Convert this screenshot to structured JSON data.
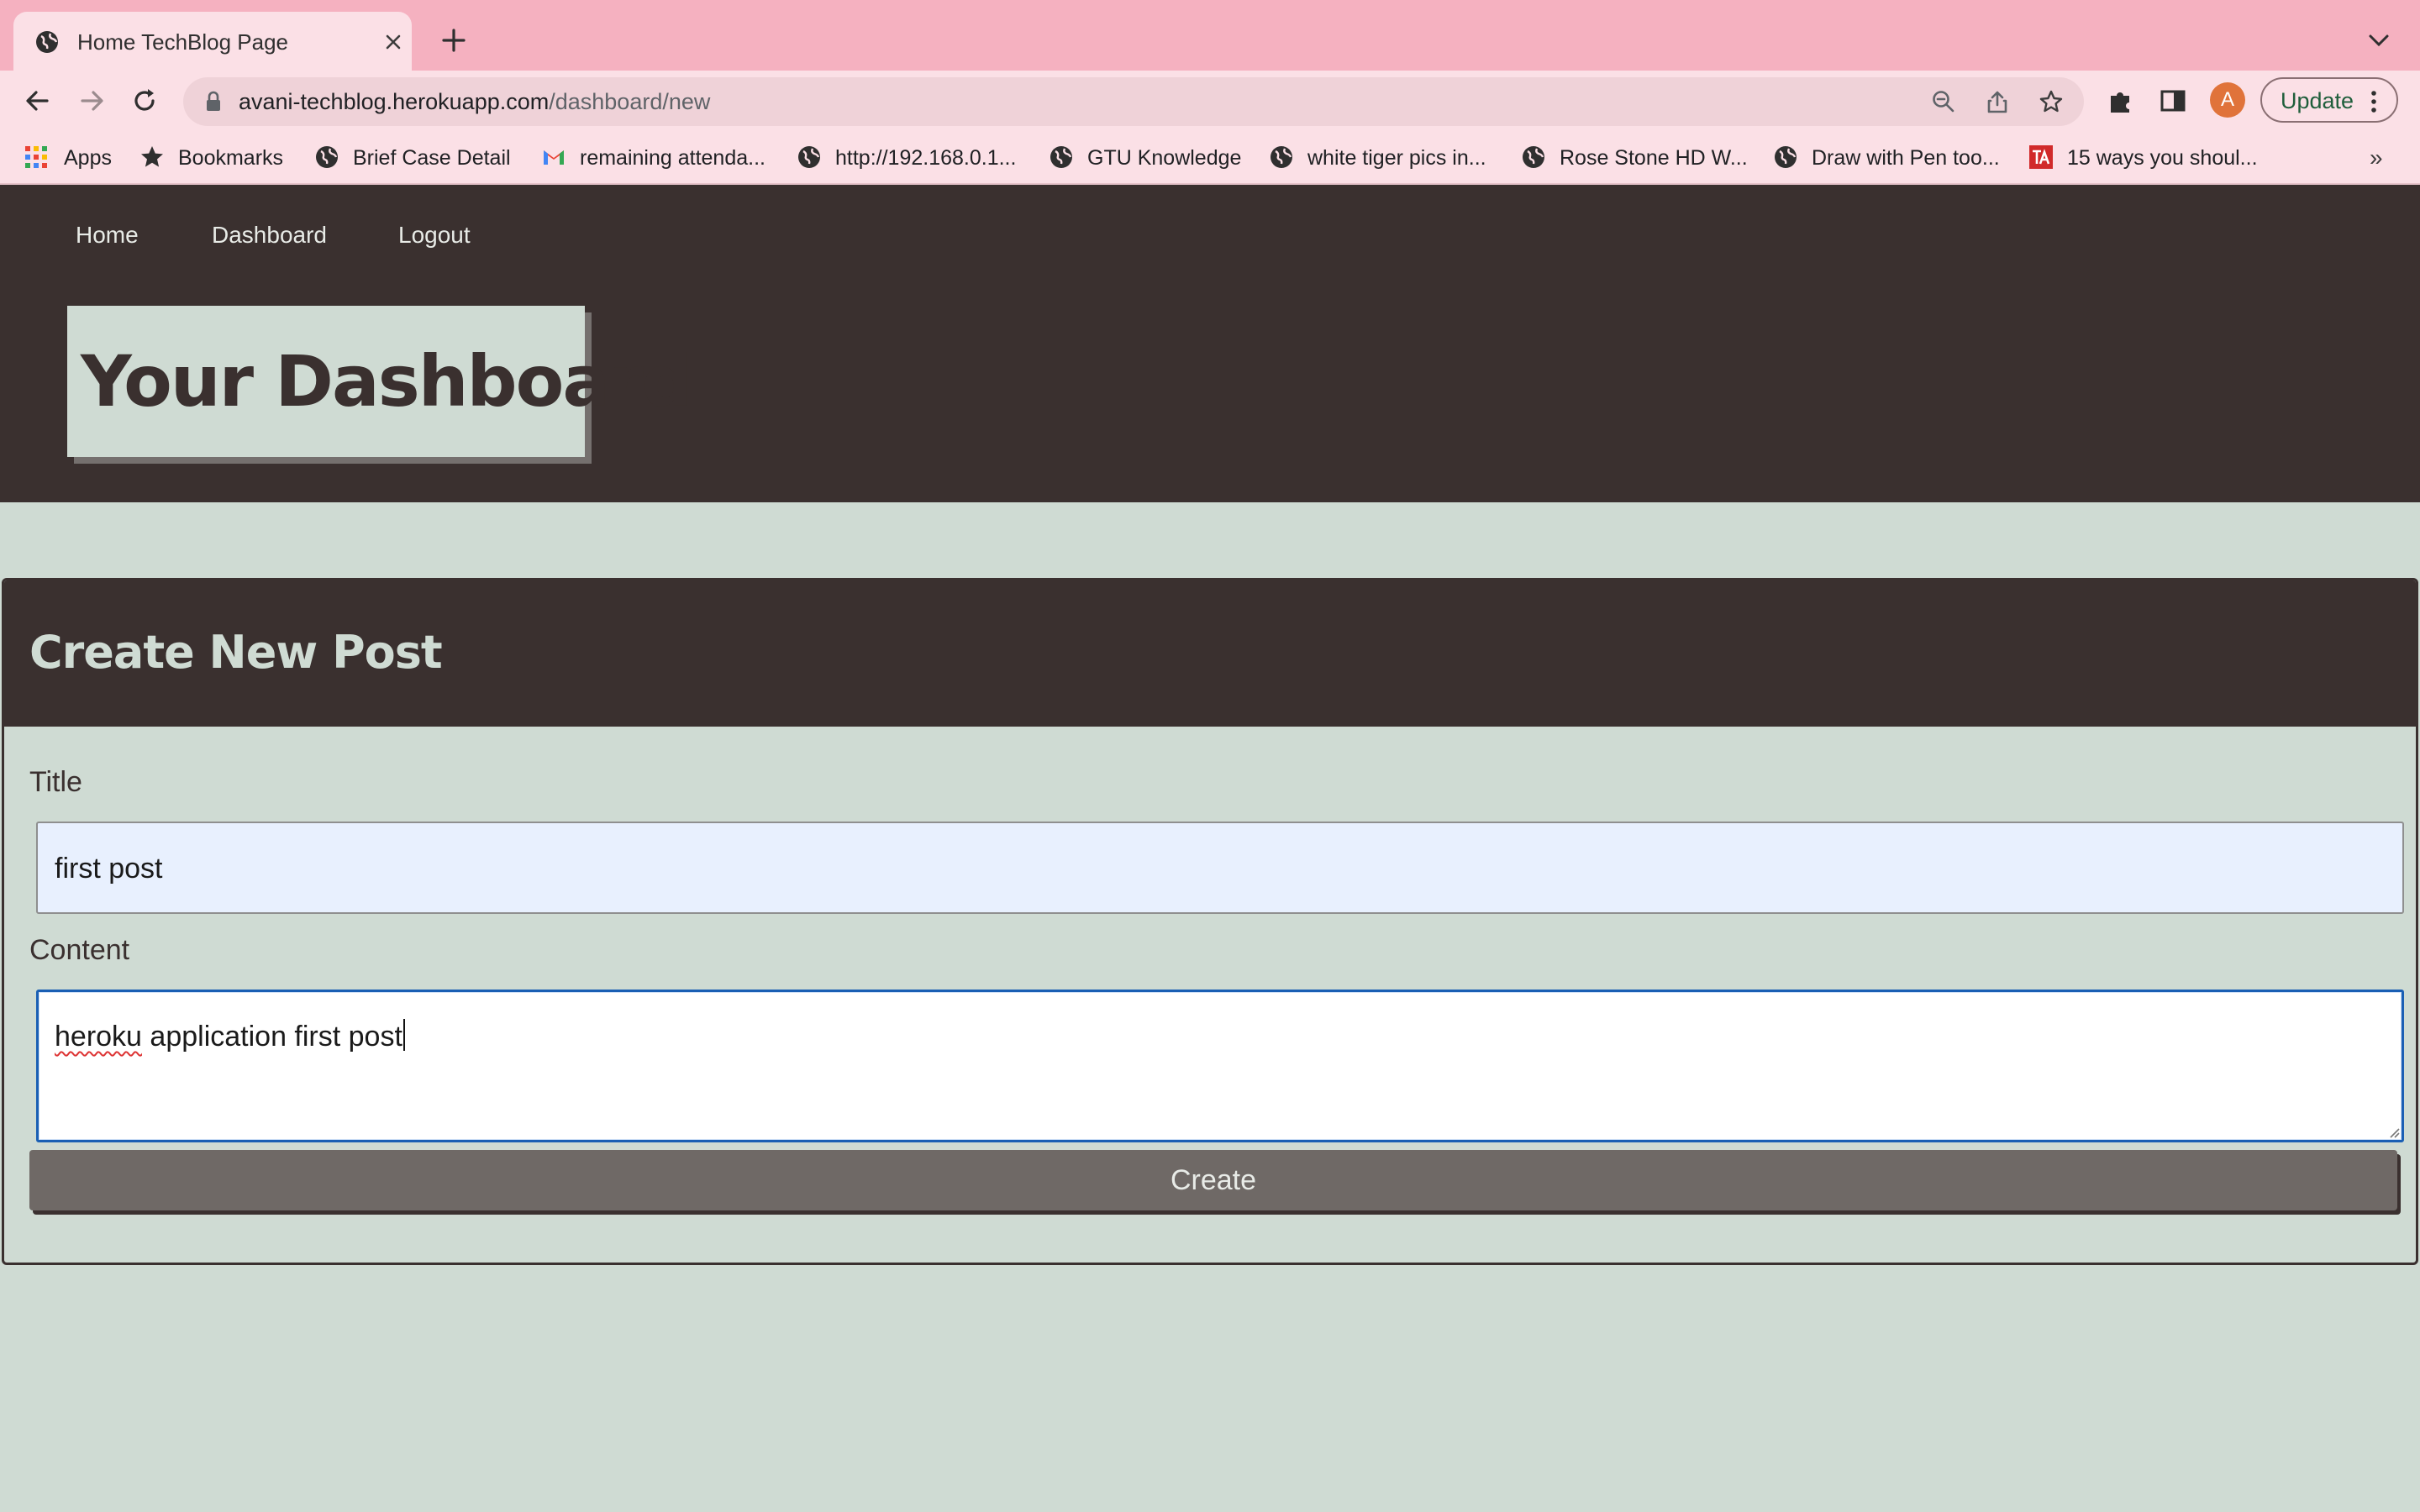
{
  "browser": {
    "tab_title": "Home TechBlog Page",
    "url_host": "avani-techblog.herokuapp.com",
    "url_path": "/dashboard/new",
    "profile_initial": "A",
    "update_label": "Update",
    "bookmarks": [
      {
        "label": "Apps",
        "icon": "apps-grid-icon"
      },
      {
        "label": "Bookmarks",
        "icon": "star-icon"
      },
      {
        "label": "Brief Case Detail",
        "icon": "globe-icon"
      },
      {
        "label": "remaining attenda...",
        "icon": "gmail-icon"
      },
      {
        "label": "http://192.168.0.1...",
        "icon": "globe-icon"
      },
      {
        "label": "GTU Knowledge",
        "icon": "globe-icon"
      },
      {
        "label": "white tiger pics in...",
        "icon": "globe-icon"
      },
      {
        "label": "Rose Stone HD W...",
        "icon": "globe-icon"
      },
      {
        "label": "Draw with Pen too...",
        "icon": "globe-icon"
      },
      {
        "label": "15 ways you shoul...",
        "icon": "ta-icon"
      }
    ],
    "more_label": "»"
  },
  "nav": {
    "home": "Home",
    "dashboard": "Dashboard",
    "logout": "Logout"
  },
  "page": {
    "title": "Your Dashboard"
  },
  "form": {
    "heading": "Create New Post",
    "title_label": "Title",
    "title_value": "first post",
    "content_label": "Content",
    "content_word1": "heroku",
    "content_rest": " application first post",
    "submit_label": "Create"
  },
  "colors": {
    "header_bg": "#3a302f",
    "page_bg": "#cfdbd3",
    "tab_strip": "#f5b1c0",
    "button_bg": "#6f6966",
    "focus_ring": "#1a5fb4"
  }
}
